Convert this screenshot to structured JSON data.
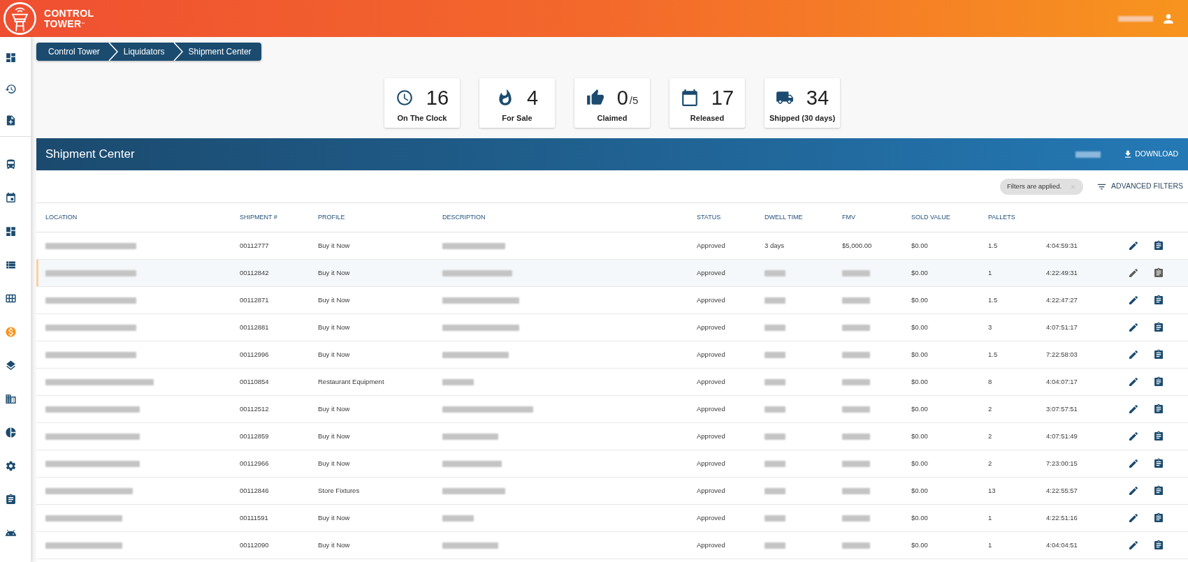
{
  "header": {
    "logo_lines": [
      "CONTROL",
      "TOWER$^{™}$"
    ]
  },
  "sidebar": {
    "groups": [
      [
        {
          "selected": false
        },
        {
          "selected": false
        },
        {
          "selected": false
        }
      ],
      [
        {
          "selected": false
        },
        {
          "selected": false
        },
        {
          "selected": false
        },
        {
          "selected": false
        },
        {
          "selected": false
        },
        {
          "selected": true
        },
        {
          "selected": false
        },
        {
          "selected": false
        },
        {
          "selected": false
        },
        {
          "selected": false
        },
        {
          "selected": false
        },
        {
          "selected": false
        }
      ]
    ]
  },
  "breadcrumb": [
    "Control Tower",
    "Liquidators",
    "Shipment Center"
  ],
  "stats": [
    {
      "value": "16",
      "label": "On The Clock"
    },
    {
      "value": "4",
      "label": "For Sale"
    },
    {
      "value": "0",
      "total": "/5",
      "label": "Claimed"
    },
    {
      "value": "17",
      "label": "Released"
    },
    {
      "value": "34",
      "label": "Shipped (30 days)"
    }
  ],
  "panel": {
    "title": "Shipment Center",
    "download": "DOWNLOAD",
    "filter_chip": "Filters are applied.",
    "advanced_filters": "ADVANCED FILTERS"
  },
  "table": {
    "columns": [
      "LOCATION",
      "SHIPMENT #",
      "PROFILE",
      "DESCRIPTION",
      "STATUS",
      "DWELL TIME",
      "FMV",
      "SOLD VALUE",
      "PALLETS"
    ],
    "rows": [
      {
        "selected": false,
        "shipment": "00112777",
        "profile": "Buy it Now",
        "status": "Approved",
        "dwell_time": "3 days",
        "fmv": "$5,000.00",
        "sold_value": "$0.00",
        "pallets": "1.5",
        "column_10": "4:04:59:31"
      },
      {
        "selected": true,
        "shipment": "00112842",
        "profile": "Buy it Now",
        "status": "Approved",
        "sold_value": "$0.00",
        "pallets": "1",
        "column_10": "4:22:49:31"
      },
      {
        "selected": false,
        "shipment": "00112871",
        "profile": "Buy it Now",
        "status": "Approved",
        "sold_value": "$0.00",
        "pallets": "1.5",
        "column_10": "4:22:47:27"
      },
      {
        "selected": false,
        "shipment": "00112881",
        "profile": "Buy it Now",
        "status": "Approved",
        "sold_value": "$0.00",
        "pallets": "3",
        "column_10": "4:07:51:17"
      },
      {
        "selected": false,
        "shipment": "00112996",
        "profile": "Buy it Now",
        "status": "Approved",
        "sold_value": "$0.00",
        "pallets": "1.5",
        "column_10": "7:22:58:03"
      },
      {
        "selected": false,
        "shipment": "00110854",
        "profile": "Restaurant Equipment",
        "status": "Approved",
        "sold_value": "$0.00",
        "pallets": "8",
        "column_10": "4:04:07:17"
      },
      {
        "selected": false,
        "shipment": "00112512",
        "profile": "Buy it Now",
        "status": "Approved",
        "sold_value": "$0.00",
        "pallets": "2",
        "column_10": "3:07:57:51"
      },
      {
        "selected": false,
        "shipment": "00112859",
        "profile": "Buy it Now",
        "status": "Approved",
        "sold_value": "$0.00",
        "pallets": "2",
        "column_10": "4:07:51:49"
      },
      {
        "selected": false,
        "shipment": "00112966",
        "profile": "Buy it Now",
        "status": "Approved",
        "sold_value": "$0.00",
        "pallets": "2",
        "column_10": "7:23:00:15"
      },
      {
        "selected": false,
        "shipment": "00112846",
        "profile": "Store Fixtures",
        "status": "Approved",
        "sold_value": "$0.00",
        "pallets": "13",
        "column_10": "4:22:55:57"
      },
      {
        "selected": false,
        "shipment": "00111591",
        "profile": "Buy it Now",
        "status": "Approved",
        "sold_value": "$0.00",
        "pallets": "1",
        "column_10": "4:22:51:16"
      },
      {
        "selected": false,
        "shipment": "00112090",
        "profile": "Buy it Now",
        "status": "Approved",
        "sold_value": "$0.00",
        "pallets": "1",
        "column_10": "4:04:04:51"
      }
    ]
  }
}
